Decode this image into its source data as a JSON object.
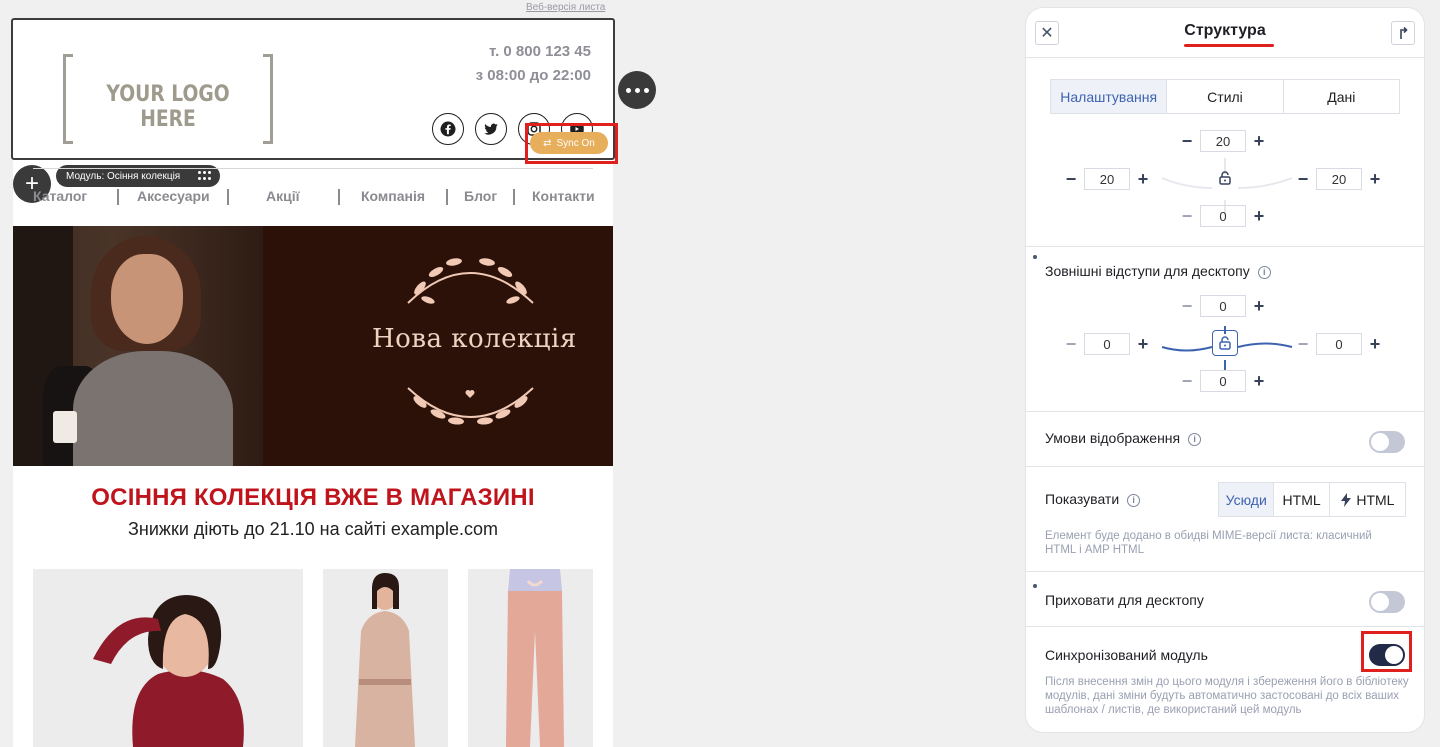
{
  "email": {
    "web_version_link": "Веб-версія листа",
    "logo_text": "YOUR LOGO HERE",
    "phone": "т. 0 800 123 45",
    "hours": "з 08:00 до 22:00",
    "social_icons": [
      "facebook-icon",
      "twitter-icon",
      "instagram-icon",
      "youtube-icon"
    ],
    "sync_badge": "Sync On",
    "module_label": "Модуль: Осіння колекція",
    "nav": [
      "Каталог",
      "Аксесуари",
      "Акції",
      "Компанія",
      "Блог",
      "Контакти"
    ],
    "banner_title": "Нова колекція",
    "headline": "ОСІННЯ КОЛЕКЦІЯ ВЖЕ В МАГАЗИНІ",
    "subheadline": "Знижки діють до 21.10 на сайті example.com",
    "colors": {
      "headline": "#c0141d",
      "sync_badge": "#e7ae5b",
      "banner_bg": "#2b1108"
    }
  },
  "panel": {
    "title": "Структура",
    "close_icon": "close-icon",
    "pin_icon": "pin-icon",
    "tabs": [
      {
        "label": "Налаштування",
        "active": true
      },
      {
        "label": "Стилі",
        "active": false
      },
      {
        "label": "Дані",
        "active": false
      }
    ],
    "padding": {
      "top": "20",
      "left": "20",
      "right": "20",
      "bottom": "0"
    },
    "margin": {
      "label": "Зовнішні відступи для десктопу",
      "top": "0",
      "left": "0",
      "right": "0",
      "bottom": "0"
    },
    "display_conditions": {
      "label": "Умови відображення",
      "enabled": false
    },
    "show": {
      "label": "Показувати",
      "options": [
        "Усюди",
        "HTML",
        "HTML"
      ],
      "selected": "Усюди",
      "hint": "Елемент буде додано в обидві MIME-версії листа: класичний HTML і AMP HTML"
    },
    "hide_desktop": {
      "label": "Приховати для десктопу",
      "enabled": false
    },
    "synced_module": {
      "label": "Синхронізований модуль",
      "enabled": true,
      "hint": "Після внесення змін до цього модуля і збереження його в бібліотеку модулів, дані зміни будуть автоматично застосовані до всіх ваших шаблонах / листів, де використаний цей модуль"
    },
    "colors": {
      "accent": "#3d63b0",
      "toggle_on": "#212a47",
      "highlight": "#e0201d"
    }
  }
}
